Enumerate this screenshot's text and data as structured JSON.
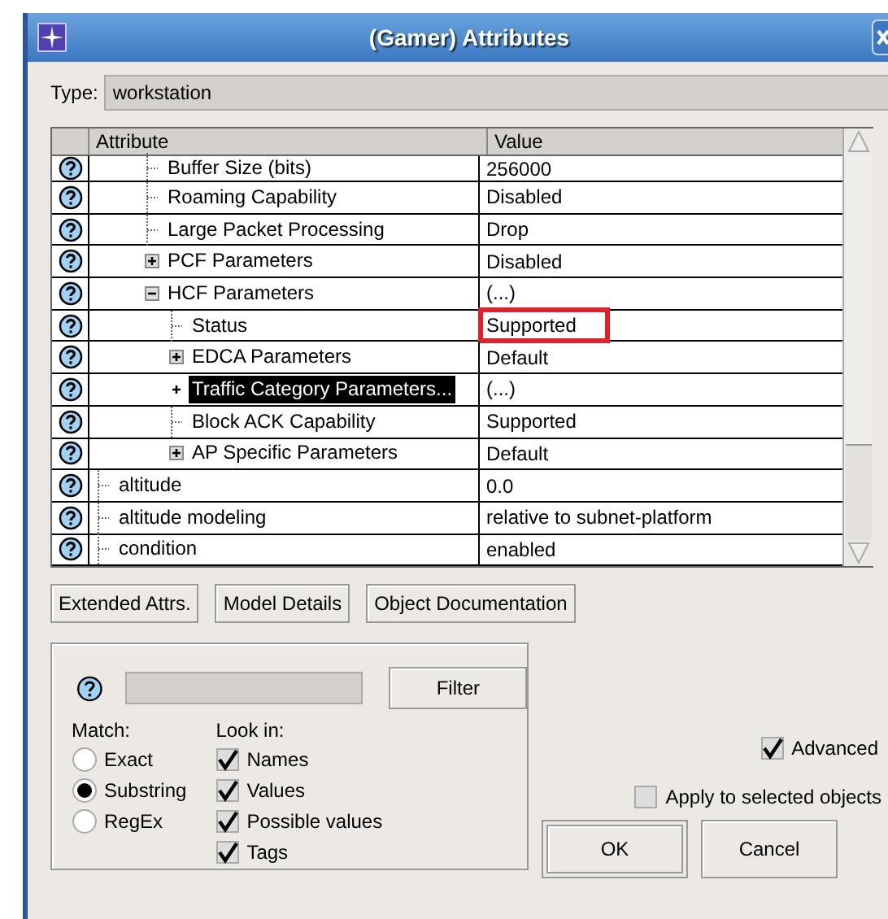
{
  "window": {
    "title": "(Gamer) Attributes"
  },
  "type_field": {
    "label": "Type:",
    "value": "workstation"
  },
  "table": {
    "columns": [
      "Attribute",
      "Value"
    ],
    "tree": [
      {
        "children": [
          {
            "children": [
              {
                "name": "Buffer Size (bits)",
                "value": "256000",
                "selected": false
              },
              {
                "name": "Roaming Capability",
                "value": "Disabled",
                "selected": false
              },
              {
                "name": "Large Packet Processing",
                "value": "Drop",
                "selected": false
              },
              {
                "name": "PCF Parameters",
                "value": "Disabled",
                "selected": false,
                "expanded": false
              },
              {
                "name": "HCF Parameters",
                "value": "(...)",
                "selected": false,
                "expanded": true,
                "children": [
                  {
                    "name": "Status",
                    "value": "Supported",
                    "selected": false,
                    "outlined": true
                  },
                  {
                    "name": "EDCA Parameters",
                    "value": "Default",
                    "selected": false,
                    "expanded": false
                  },
                  {
                    "name": "Traffic Category Parameters...",
                    "value": "(...)",
                    "selected": true,
                    "expanded": false
                  },
                  {
                    "name": "Block ACK Capability",
                    "value": "Supported",
                    "selected": false
                  },
                  {
                    "name": "AP Specific Parameters",
                    "value": "Default",
                    "selected": false,
                    "expanded": false
                  }
                ]
              }
            ]
          }
        ]
      },
      {
        "name": "altitude",
        "value": "0.0",
        "selected": false
      },
      {
        "name": "altitude modeling",
        "value": "relative to subnet-platform",
        "selected": false
      },
      {
        "name": "condition",
        "value": "enabled",
        "selected": false
      }
    ]
  },
  "action_buttons": [
    "Extended Attrs.",
    "Model Details",
    "Object Documentation"
  ],
  "filter": {
    "button": "Filter",
    "match_label": "Match:",
    "match_options": [
      {
        "label": "Exact",
        "selected": false
      },
      {
        "label": "Substring",
        "selected": true
      },
      {
        "label": "RegEx",
        "selected": false
      }
    ],
    "look_in_label": "Look in:",
    "look_in": [
      {
        "label": "Names",
        "checked": true
      },
      {
        "label": "Values",
        "checked": true
      },
      {
        "label": "Possible values",
        "checked": true
      },
      {
        "label": "Tags",
        "checked": true
      }
    ]
  },
  "advanced": {
    "label": "Advanced",
    "checked": true
  },
  "apply_selected": {
    "label": "Apply to selected objects",
    "checked": false
  },
  "dialog_buttons": [
    "OK",
    "Cancel"
  ]
}
